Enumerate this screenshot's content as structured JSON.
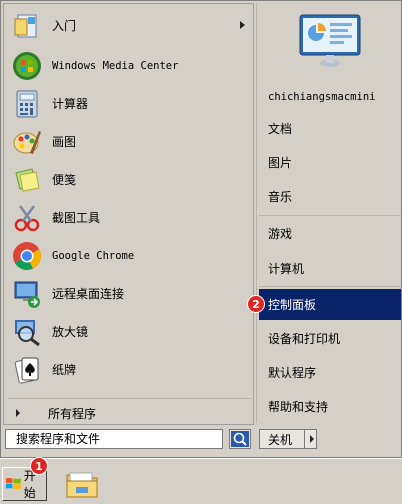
{
  "start_menu": {
    "programs": [
      {
        "label": "入门",
        "icon": "getting-started-icon",
        "has_submenu": true
      },
      {
        "label": "Windows Media Center",
        "icon": "windows-media-center-icon",
        "has_submenu": false
      },
      {
        "label": "计算器",
        "icon": "calculator-icon",
        "has_submenu": false
      },
      {
        "label": "画图",
        "icon": "paint-icon",
        "has_submenu": false
      },
      {
        "label": "便笺",
        "icon": "sticky-notes-icon",
        "has_submenu": false
      },
      {
        "label": "截图工具",
        "icon": "snipping-tool-icon",
        "has_submenu": false
      },
      {
        "label": "Google Chrome",
        "icon": "chrome-icon",
        "has_submenu": false
      },
      {
        "label": "远程桌面连接",
        "icon": "remote-desktop-icon",
        "has_submenu": false
      },
      {
        "label": "放大镜",
        "icon": "magnifier-icon",
        "has_submenu": false
      },
      {
        "label": "纸牌",
        "icon": "solitaire-icon",
        "has_submenu": false
      }
    ],
    "all_programs_label": "所有程序",
    "search": {
      "placeholder": "搜索程序和文件"
    },
    "right_items": [
      {
        "label": "chichiangsmacmini"
      },
      {
        "label": "文档"
      },
      {
        "label": "图片"
      },
      {
        "label": "音乐"
      },
      {
        "label": "游戏"
      },
      {
        "label": "计算机"
      },
      {
        "label": "控制面板",
        "selected": true
      },
      {
        "label": "设备和打印机"
      },
      {
        "label": "默认程序"
      },
      {
        "label": "帮助和支持"
      }
    ],
    "shutdown_label": "关机"
  },
  "taskbar": {
    "start_label": "开始",
    "pinned": [
      {
        "icon": "file-explorer-icon"
      }
    ]
  },
  "annotations": {
    "step1": "1",
    "step2": "2"
  },
  "colors": {
    "menu_bg": "#d4d0c8",
    "selected_bg": "#0a246a",
    "badge": "#e02424"
  }
}
